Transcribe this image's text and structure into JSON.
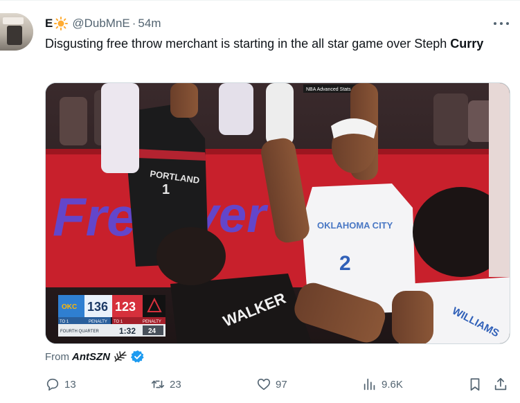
{
  "tweet": {
    "display_name": "E",
    "display_name_emoji": "sun-emoji-icon",
    "handle": "@DubMnE",
    "separator": "·",
    "time": "54m",
    "text_main": "Disgusting free throw merchant is starting in the all star game over Steph",
    "text_bold": "Curry",
    "media": {
      "broadcaster_tag": "NBA Advanced Stats",
      "court_banner": "Free",
      "court_banner_2": "ver",
      "player_left_jersey": "WALKER",
      "player_right_jersey": "WILLIAMS",
      "player_center_team": "OKLAHOMA CITY",
      "player_center_number": "2",
      "player_left_top_team": "PORTLAND",
      "player_left_top_number": "1",
      "scorebug": {
        "home_score": "136",
        "away_score": "123",
        "home_timeouts": "TO 1",
        "away_timeouts": "TO 1",
        "home_status": "PENALTY",
        "away_status": "PENALTY",
        "period": "FOURTH QUARTER",
        "clock": "1:32",
        "shot_clock": "24"
      }
    },
    "from_label": "From",
    "from_source": "AntSZN",
    "actions": {
      "replies": "13",
      "reposts": "23",
      "likes": "97",
      "views": "9.6K"
    },
    "colors": {
      "text": "#0f1419",
      "secondary": "#536471",
      "verified": "#1d9bf0",
      "home_team": "#2f7fd1",
      "away_team": "#d6303c"
    }
  }
}
